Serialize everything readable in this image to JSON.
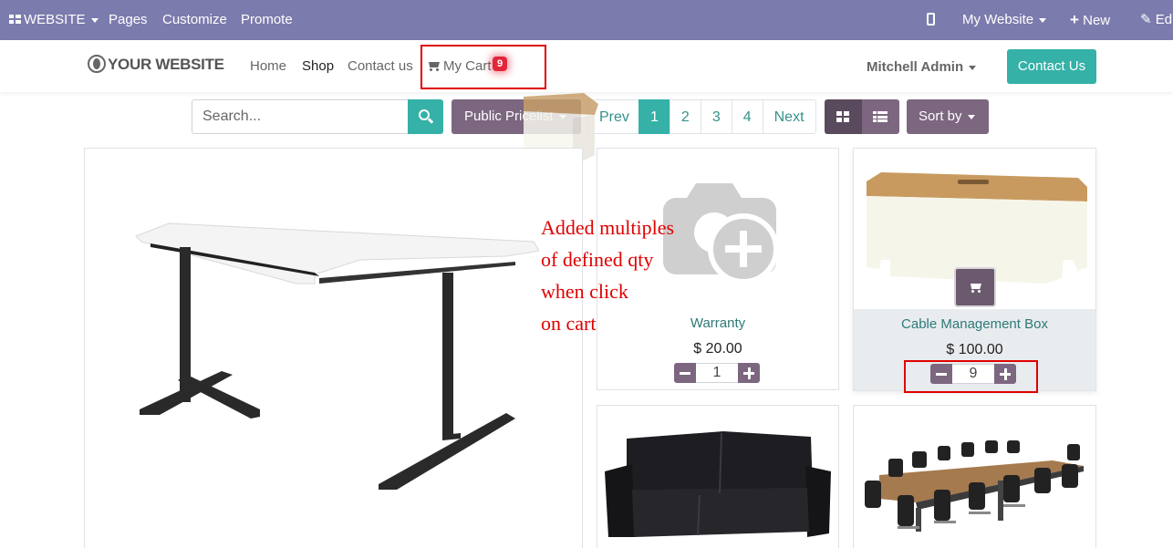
{
  "adminbar": {
    "website_menu": "WEBSITE",
    "pages": "Pages",
    "customize": "Customize",
    "promote": "Promote",
    "my_website": "My Website",
    "new": "New",
    "edit": "Edit"
  },
  "navbar": {
    "logo": "YOUR WEBSITE",
    "links": [
      "Home",
      "Shop",
      "Contact us"
    ],
    "active_link": "Shop",
    "cart_label": "My Cart",
    "cart_count": "9",
    "user": "Mitchell Admin",
    "contact_button": "Contact Us"
  },
  "toolbar": {
    "search_placeholder": "Search...",
    "pricelist": "Public Pricelist",
    "pager": [
      "Prev",
      "1",
      "2",
      "3",
      "4",
      "Next"
    ],
    "current_page": "1",
    "sort_label": "Sort by"
  },
  "products": [
    {
      "name": "Warranty",
      "price": "$ 20.00",
      "qty": "1"
    },
    {
      "name": "Cable Management Box",
      "price": "$ 100.00",
      "qty": "9"
    }
  ],
  "annotation": [
    "Added multiples",
    "of defined qty",
    "when click",
    "on cart"
  ],
  "colors": {
    "adminbar": "#7c7bad",
    "primary": "#35b1a7",
    "secondary": "#7c6680",
    "badge": "#e2263a",
    "highlight": "#e00000"
  }
}
